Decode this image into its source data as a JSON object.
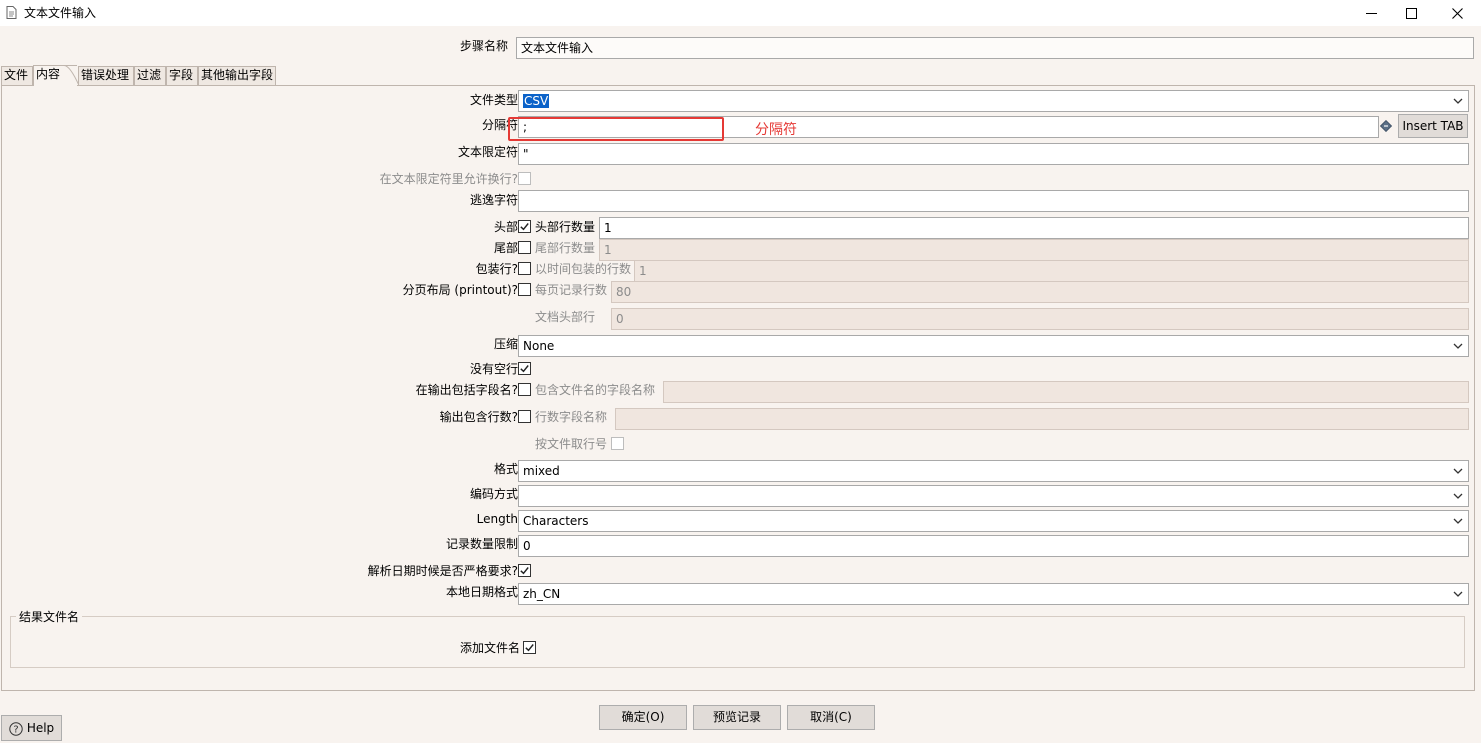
{
  "window": {
    "title": "文本文件输入",
    "minimize_glyph": "—",
    "maximize_glyph": "☐",
    "close_glyph": "✕"
  },
  "step": {
    "label": "步骤名称",
    "value": "文本文件输入"
  },
  "tabs": [
    {
      "label": "文件"
    },
    {
      "label": "内容"
    },
    {
      "label": "错误处理"
    },
    {
      "label": "过滤"
    },
    {
      "label": "字段"
    },
    {
      "label": "其他输出字段"
    }
  ],
  "active_tab": "内容",
  "content": {
    "filetype": {
      "label": "文件类型",
      "value": "CSV"
    },
    "separator": {
      "label": "分隔符",
      "value": ";",
      "insert_tab_label": "Insert TAB",
      "annotation": "分隔符"
    },
    "enclosure": {
      "label": "文本限定符",
      "value": "\""
    },
    "enclosure_breaks": {
      "label": "在文本限定符里允许换行?",
      "checked": false
    },
    "escape": {
      "label": "逃逸字符",
      "value": ""
    },
    "header": {
      "label": "头部",
      "checked": true,
      "rows_label": "头部行数量",
      "rows_value": "1"
    },
    "footer": {
      "label": "尾部",
      "checked": false,
      "rows_label": "尾部行数量",
      "rows_value": "1"
    },
    "wrap": {
      "label": "包装行?",
      "checked": false,
      "rows_label": "以时间包装的行数",
      "rows_value": "1"
    },
    "layout": {
      "label": "分页布局 (printout)?",
      "checked": false,
      "rows_label": "每页记录行数",
      "rows_value": "80",
      "doc_header_label": "文档头部行",
      "doc_header_value": "0"
    },
    "compression": {
      "label": "压缩",
      "value": "None"
    },
    "no_empty_rows": {
      "label": "没有空行",
      "checked": true
    },
    "include_filename": {
      "label": "在输出包括字段名?",
      "checked": false,
      "field_label": "包含文件名的字段名称",
      "field_value": ""
    },
    "include_rownum": {
      "label": "输出包含行数?",
      "checked": false,
      "field_label": "行数字段名称",
      "field_value": ""
    },
    "rownum_by_file": {
      "label": "按文件取行号",
      "checked": false
    },
    "format": {
      "label": "格式",
      "value": "mixed"
    },
    "encoding": {
      "label": "编码方式",
      "value": ""
    },
    "length": {
      "label": "Length",
      "value": "Characters"
    },
    "limit": {
      "label": "记录数量限制",
      "value": "0"
    },
    "date_lenient": {
      "label": "解析日期时候是否严格要求?",
      "checked": true
    },
    "locale": {
      "label": "本地日期格式",
      "value": "zh_CN"
    }
  },
  "result_file": {
    "group_title": "结果文件名",
    "add_label": "添加文件名",
    "checked": true
  },
  "buttons": {
    "ok": "确定(O)",
    "preview": "预览记录",
    "cancel": "取消(C)",
    "help": "Help"
  },
  "colors": {
    "background": "#f8f3ef",
    "highlight_box": "#e53935",
    "annotation_text": "#e53935",
    "selection": "#0a62c9"
  }
}
